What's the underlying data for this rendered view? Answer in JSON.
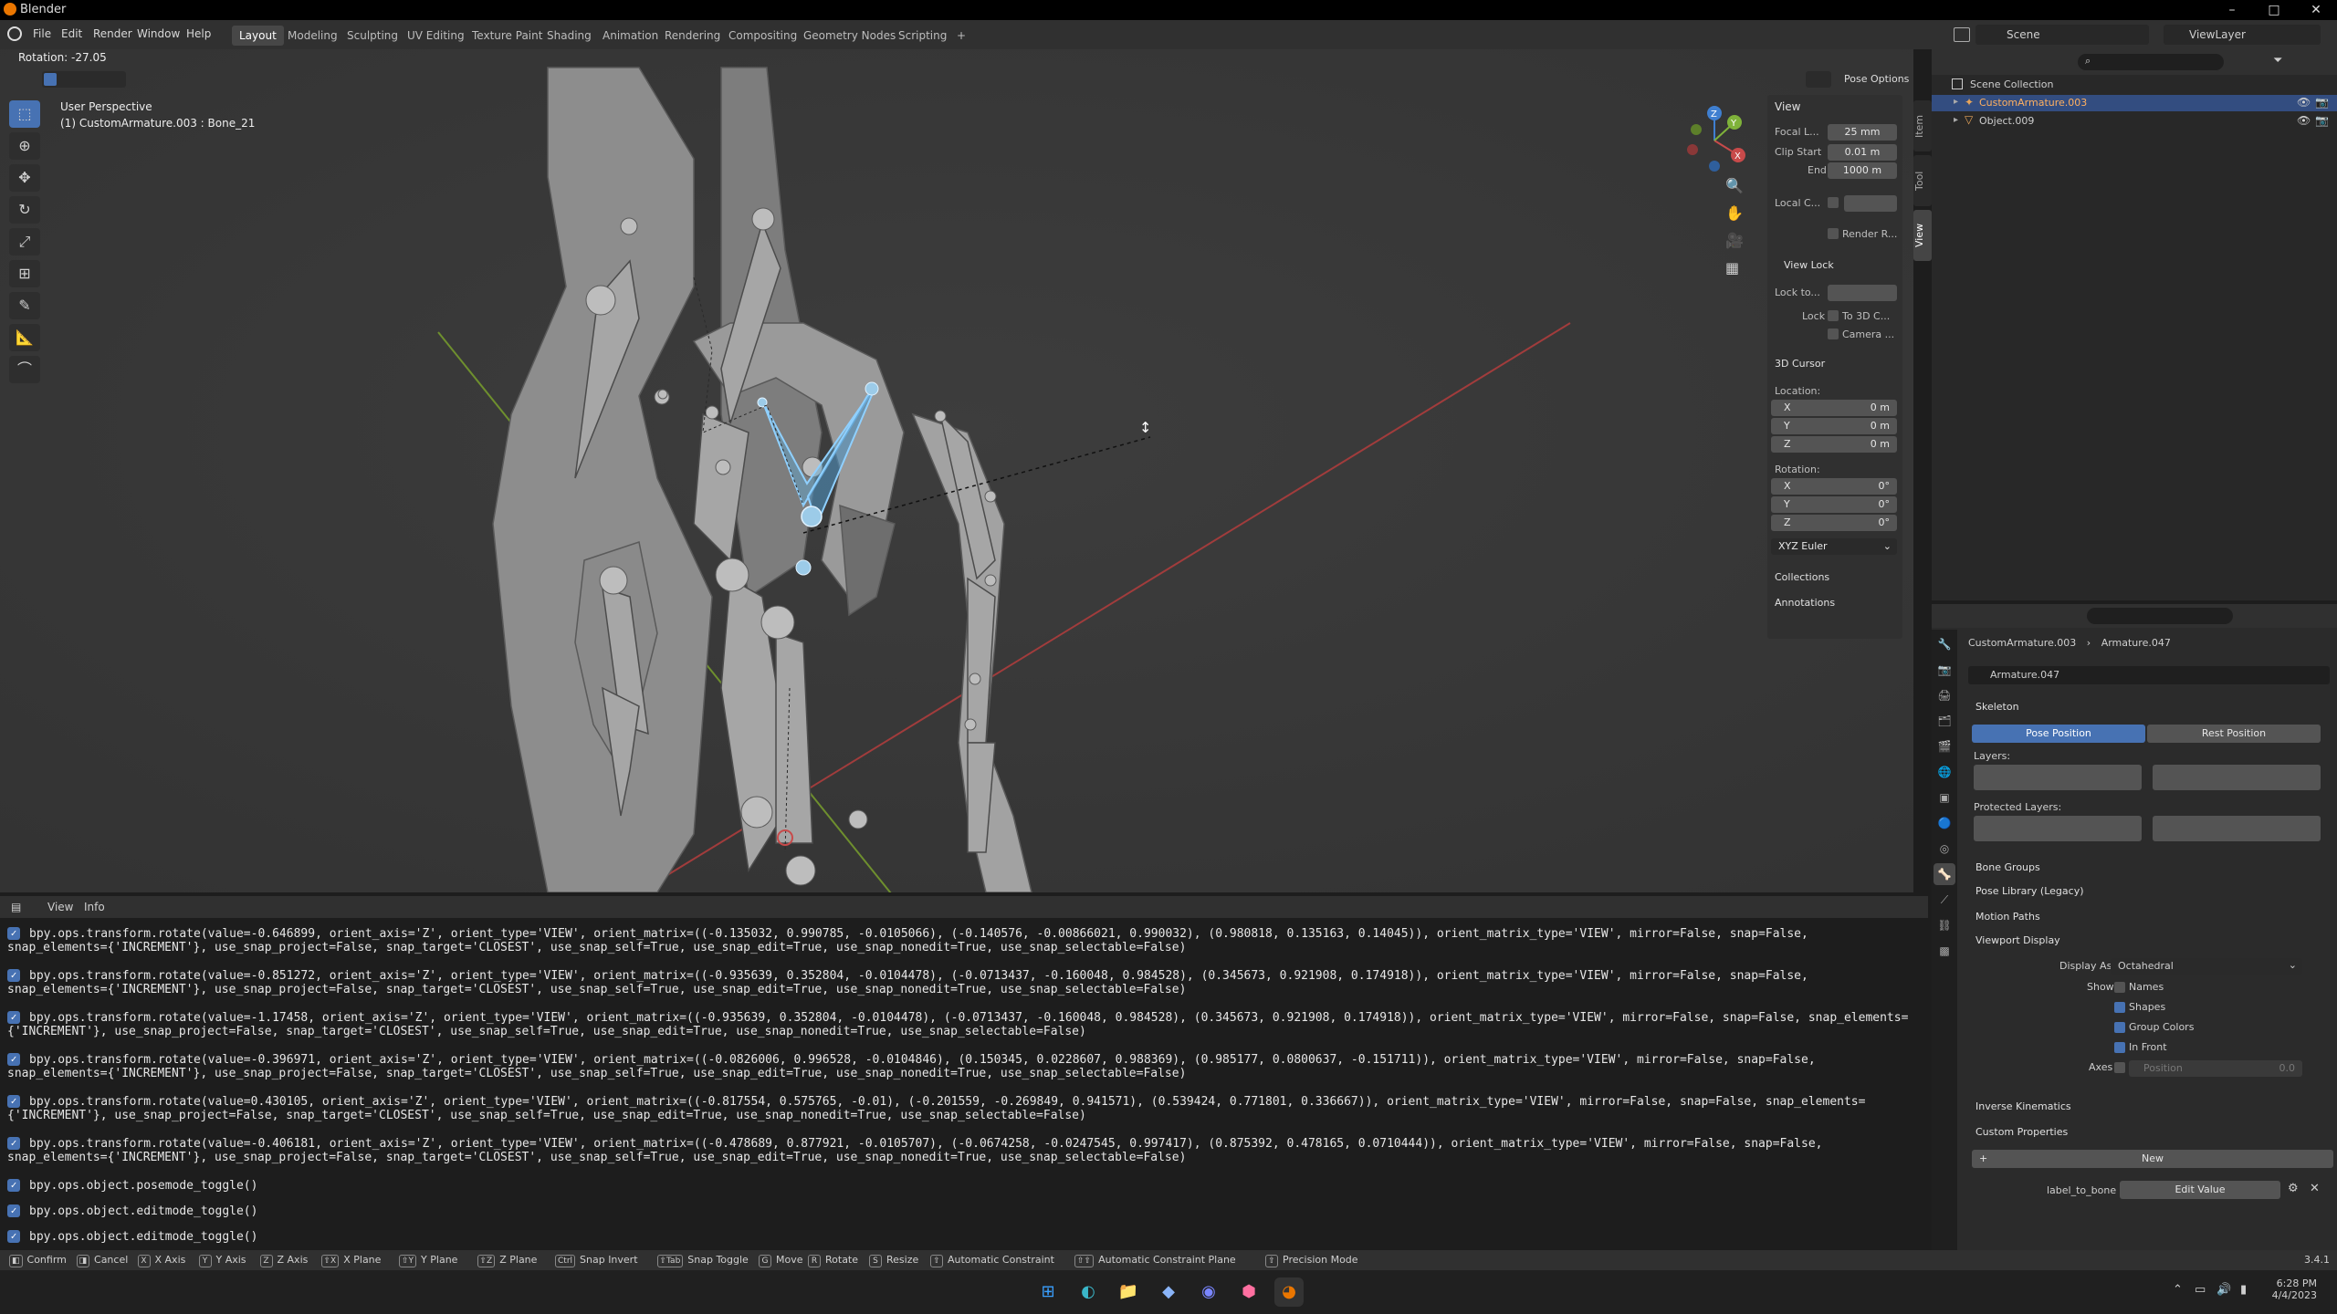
{
  "window": {
    "title": "Blender",
    "controls": [
      "–",
      "□",
      "✕"
    ]
  },
  "menubar": {
    "menus": [
      "File",
      "Edit",
      "Render",
      "Window",
      "Help"
    ],
    "workspaces": [
      "Layout",
      "Modeling",
      "Sculpting",
      "UV Editing",
      "Texture Paint",
      "Shading",
      "Animation",
      "Rendering",
      "Compositing",
      "Geometry Nodes",
      "Scripting",
      "+"
    ],
    "scene": "Scene",
    "view_layer": "ViewLayer"
  },
  "viewport": {
    "rotation_readout": "Rotation: -27.05",
    "perspective": "User Perspective",
    "object_info": "(1) CustomArmature.003 : Bone_21",
    "pose_options": "Pose Options",
    "gizmo": {
      "x": "X",
      "y": "Y",
      "z": "Z"
    }
  },
  "npanel": {
    "tabs": [
      "Item",
      "Tool",
      "View"
    ],
    "view": {
      "header": "View",
      "focal_label": "Focal L...",
      "focal_value": "25 mm",
      "clip_start_label": "Clip Start",
      "clip_start_value": "0.01 m",
      "end_label": "End",
      "end_value": "1000 m",
      "local_camera_label": "Local C...",
      "render_region": "Render R..."
    },
    "view_lock": {
      "header": "View Lock",
      "lock_to": "Lock to...",
      "lock_label": "Lock",
      "to_3d_cursor": "To 3D C...",
      "camera": "Camera ..."
    },
    "cursor": {
      "header": "3D Cursor",
      "location": "Location:",
      "loc": [
        {
          "axis": "X",
          "value": "0 m"
        },
        {
          "axis": "Y",
          "value": "0 m"
        },
        {
          "axis": "Z",
          "value": "0 m"
        }
      ],
      "rotation": "Rotation:",
      "rot": [
        {
          "axis": "X",
          "value": "0°"
        },
        {
          "axis": "Y",
          "value": "0°"
        },
        {
          "axis": "Z",
          "value": "0°"
        }
      ],
      "mode": "XYZ Euler"
    },
    "collections": "Collections",
    "annotations": "Annotations"
  },
  "outliner": {
    "root": "Scene Collection",
    "items": [
      "CustomArmature.003",
      "Object.009"
    ]
  },
  "properties": {
    "breadcrumb": {
      "object": "CustomArmature.003",
      "data": "Armature.047"
    },
    "data_name": "Armature.047",
    "skeleton": {
      "header": "Skeleton",
      "pose_position": "Pose Position",
      "rest_position": "Rest Position",
      "layers": "Layers:",
      "protected_layers": "Protected Layers:"
    },
    "sections": [
      "Bone Groups",
      "Pose Library (Legacy)",
      "Motion Paths"
    ],
    "viewport_display": {
      "header": "Viewport Display",
      "display_as_label": "Display As",
      "display_as_value": "Octahedral",
      "show_label": "Show",
      "names": "Names",
      "shapes": "Shapes",
      "group_colors": "Group Colors",
      "in_front": "In Front",
      "axes_label": "Axes",
      "position_label": "Position",
      "position_value": "0.0"
    },
    "inverse_kinematics": "Inverse Kinematics",
    "custom_properties": {
      "header": "Custom Properties",
      "new": "New",
      "prop_name": "label_to_bone",
      "edit_value": "Edit Value"
    }
  },
  "info": {
    "menus": [
      "View",
      "Info"
    ],
    "lines": [
      "bpy.ops.transform.rotate(value=-0.646899, orient_axis='Z', orient_type='VIEW', orient_matrix=((-0.135032, 0.990785, -0.0105066), (-0.140576, -0.00866021, 0.990032), (0.980818, 0.135163, 0.14045)), orient_matrix_type='VIEW', mirror=False, snap=False, snap_elements={'INCREMENT'}, use_snap_project=False, snap_target='CLOSEST', use_snap_self=True, use_snap_edit=True, use_snap_nonedit=True, use_snap_selectable=False)",
      "bpy.ops.transform.rotate(value=-0.851272, orient_axis='Z', orient_type='VIEW', orient_matrix=((-0.935639, 0.352804, -0.0104478), (-0.0713437, -0.160048, 0.984528), (0.345673, 0.921908, 0.174918)), orient_matrix_type='VIEW', mirror=False, snap=False, snap_elements={'INCREMENT'}, use_snap_project=False, snap_target='CLOSEST', use_snap_self=True, use_snap_edit=True, use_snap_nonedit=True, use_snap_selectable=False)",
      "bpy.ops.transform.rotate(value=-1.17458, orient_axis='Z', orient_type='VIEW', orient_matrix=((-0.935639, 0.352804, -0.0104478), (-0.0713437, -0.160048, 0.984528), (0.345673, 0.921908, 0.174918)), orient_matrix_type='VIEW', mirror=False, snap=False, snap_elements={'INCREMENT'}, use_snap_project=False, snap_target='CLOSEST', use_snap_self=True, use_snap_edit=True, use_snap_nonedit=True, use_snap_selectable=False)",
      "bpy.ops.transform.rotate(value=-0.396971, orient_axis='Z', orient_type='VIEW', orient_matrix=((-0.0826006, 0.996528, -0.0104846), (0.150345, 0.0228607, 0.988369), (0.985177, 0.0800637, -0.151711)), orient_matrix_type='VIEW', mirror=False, snap=False, snap_elements={'INCREMENT'}, use_snap_project=False, snap_target='CLOSEST', use_snap_self=True, use_snap_edit=True, use_snap_nonedit=True, use_snap_selectable=False)",
      "bpy.ops.transform.rotate(value=0.430105, orient_axis='Z', orient_type='VIEW', orient_matrix=((-0.817554, 0.575765, -0.01), (-0.201559, -0.269849, 0.941571), (0.539424, 0.771801, 0.336667)), orient_matrix_type='VIEW', mirror=False, snap=False, snap_elements={'INCREMENT'}, use_snap_project=False, snap_target='CLOSEST', use_snap_self=True, use_snap_edit=True, use_snap_nonedit=True, use_snap_selectable=False)",
      "bpy.ops.transform.rotate(value=-0.406181, orient_axis='Z', orient_type='VIEW', orient_matrix=((-0.478689, 0.877921, -0.0105707), (-0.0674258, -0.0247545, 0.997417), (0.875392, 0.478165, 0.0710444)), orient_matrix_type='VIEW', mirror=False, snap=False, snap_elements={'INCREMENT'}, use_snap_project=False, snap_target='CLOSEST', use_snap_self=True, use_snap_edit=True, use_snap_nonedit=True, use_snap_selectable=False)",
      "bpy.ops.object.posemode_toggle()",
      "bpy.ops.object.editmode_toggle()",
      "bpy.ops.object.editmode_toggle()"
    ]
  },
  "statusbar": {
    "items": [
      {
        "key": "◧",
        "label": "Confirm"
      },
      {
        "key": "◨",
        "label": "Cancel"
      },
      {
        "key": "X",
        "label": "X Axis"
      },
      {
        "key": "Y",
        "label": "Y Axis"
      },
      {
        "key": "Z",
        "label": "Z Axis"
      },
      {
        "key": "⇧X",
        "label": "X Plane"
      },
      {
        "key": "⇧Y",
        "label": "Y Plane"
      },
      {
        "key": "⇧Z",
        "label": "Z Plane"
      },
      {
        "key": "Ctrl",
        "label": "Snap Invert"
      },
      {
        "key": "⇧Tab",
        "label": "Snap Toggle"
      },
      {
        "key": "G",
        "label": "Move"
      },
      {
        "key": "R",
        "label": "Rotate"
      },
      {
        "key": "S",
        "label": "Resize"
      },
      {
        "key": "⇧",
        "label": "Automatic Constraint"
      },
      {
        "key": "⇧⇧",
        "label": "Automatic Constraint Plane"
      },
      {
        "key": "⇧",
        "label": "Precision Mode"
      }
    ],
    "version": "3.4.1"
  },
  "taskbar": {
    "time": "6:28 PM",
    "date": "4/4/2023"
  },
  "colors": {
    "accent": "#4772b3",
    "selected_bone": "#5fa8d3",
    "x_axis": "#c84a4a",
    "y_axis": "#7fb23a",
    "z_axis": "#3f7fd0"
  }
}
